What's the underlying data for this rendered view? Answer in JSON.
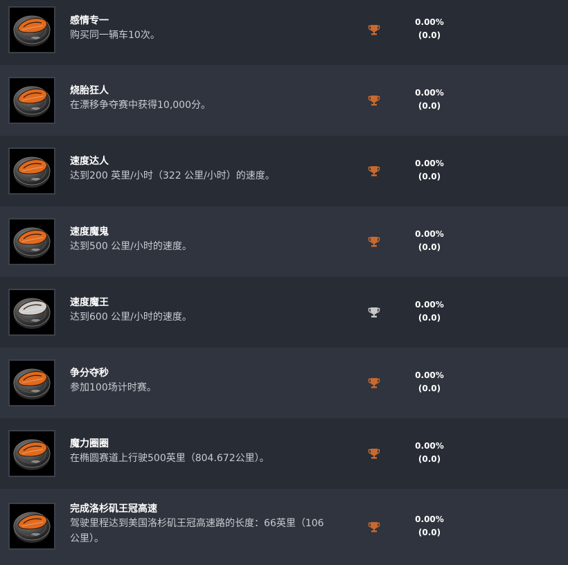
{
  "colors": {
    "row_dark": "#272c35",
    "row_light": "#2f343e",
    "trophy_bronze": "#c8692e",
    "trophy_silver": "#c8c8c8",
    "badge_orange": "#e06a1e",
    "badge_silver": "#cfcfcf"
  },
  "achievements": [
    {
      "name": "感情专一",
      "desc": "购买同一辆车10次。",
      "percent": "0.00%",
      "points": "(0.0)",
      "tier": "bronze",
      "badge_icon": "orange-car-coin-icon"
    },
    {
      "name": "烧胎狂人",
      "desc": "在漂移争夺赛中获得10,000分。",
      "percent": "0.00%",
      "points": "(0.0)",
      "tier": "bronze",
      "badge_icon": "orange-car-coin-icon"
    },
    {
      "name": "速度达人",
      "desc": "达到200 英里/小时（322 公里/小时）的速度。",
      "percent": "0.00%",
      "points": "(0.0)",
      "tier": "bronze",
      "badge_icon": "orange-car-coin-icon"
    },
    {
      "name": "速度魔鬼",
      "desc": "达到500 公里/小时的速度。",
      "percent": "0.00%",
      "points": "(0.0)",
      "tier": "bronze",
      "badge_icon": "orange-car-coin-icon"
    },
    {
      "name": "速度魔王",
      "desc": "达到600 公里/小时的速度。",
      "percent": "0.00%",
      "points": "(0.0)",
      "tier": "silver",
      "badge_icon": "silver-car-coin-icon"
    },
    {
      "name": "争分夺秒",
      "desc": "参加100场计时赛。",
      "percent": "0.00%",
      "points": "(0.0)",
      "tier": "bronze",
      "badge_icon": "orange-car-coin-icon"
    },
    {
      "name": "魔力圈圈",
      "desc": "在椭圆赛道上行驶500英里（804.672公里）。",
      "percent": "0.00%",
      "points": "(0.0)",
      "tier": "bronze",
      "badge_icon": "orange-car-coin-icon"
    },
    {
      "name": "完成洛杉矶王冠高速",
      "desc": "驾驶里程达到美国洛杉矶王冠高速路的长度：66英里（106公里）。",
      "percent": "0.00%",
      "points": "(0.0)",
      "tier": "bronze",
      "badge_icon": "orange-car-coin-icon"
    }
  ]
}
